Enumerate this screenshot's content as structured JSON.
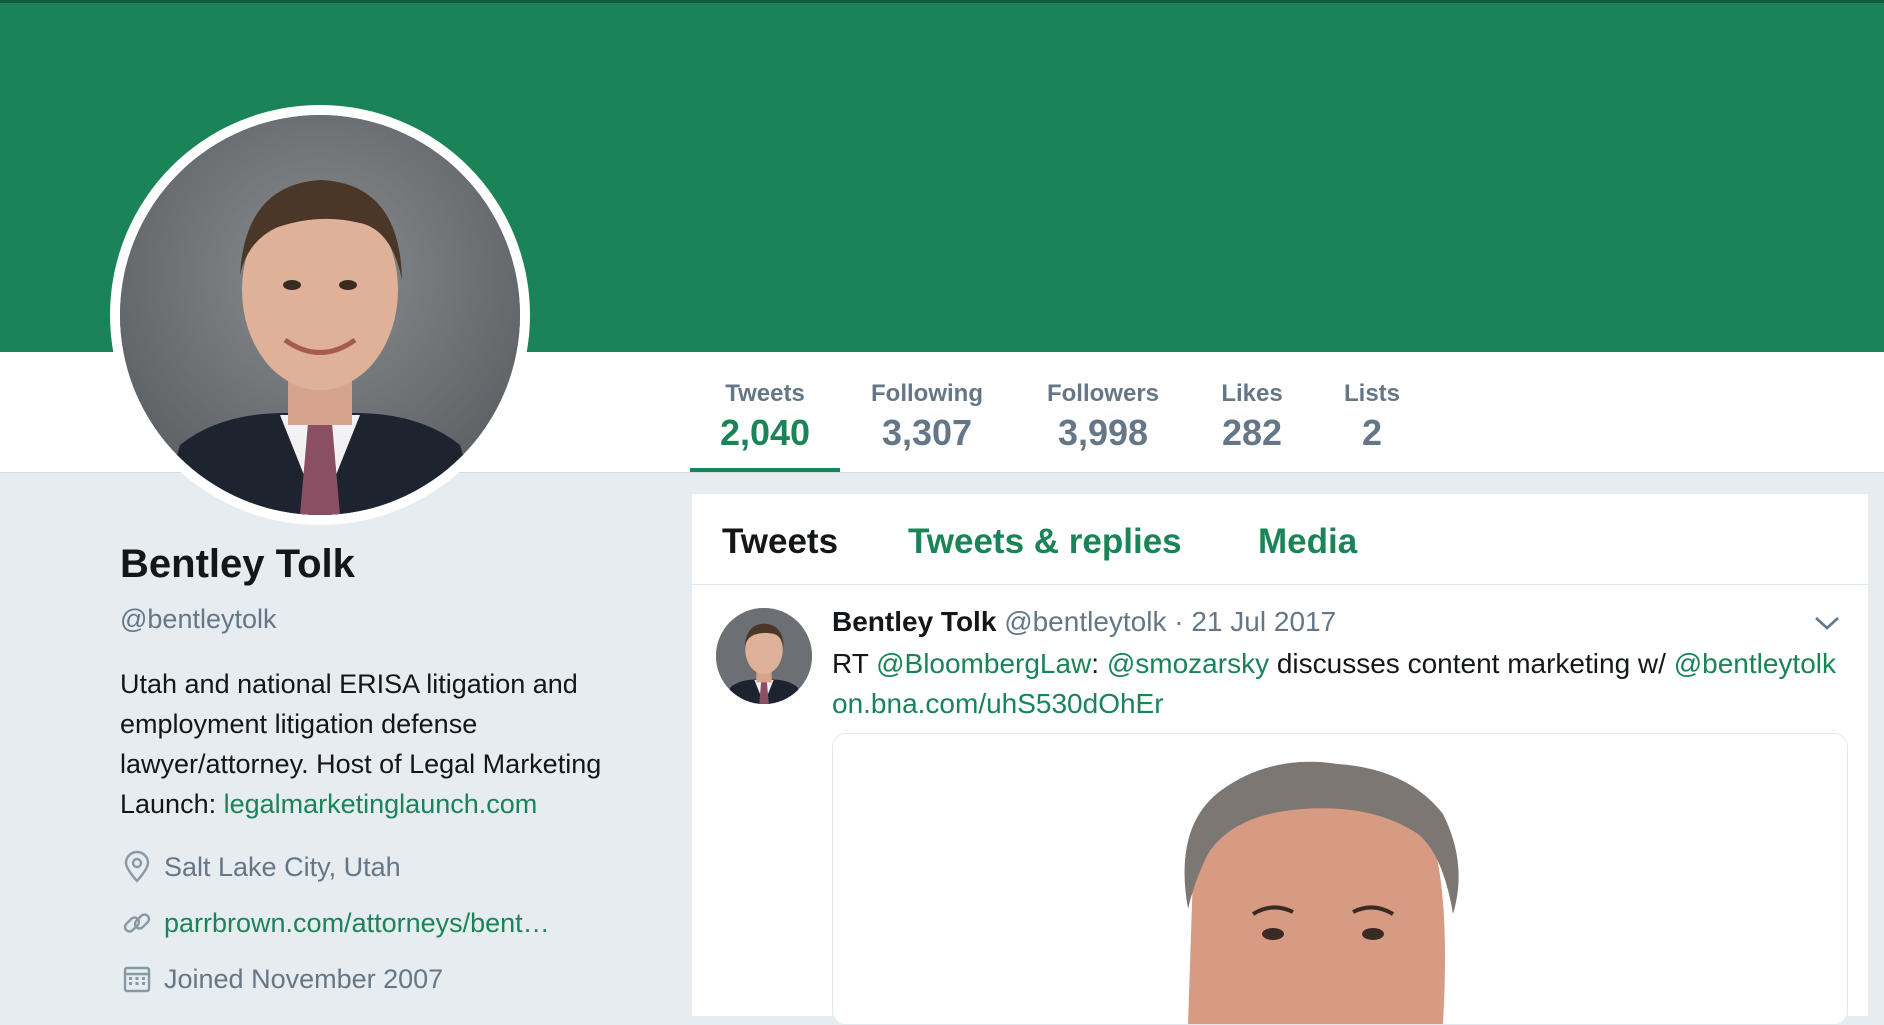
{
  "profile": {
    "name": "Bentley Tolk",
    "handle": "@bentleytolk",
    "bio_text": "Utah and national ERISA litigation and employment litigation defense lawyer/attorney. Host of Legal Marketing Launch: ",
    "bio_link": "legalmarketinglaunch.com",
    "location": "Salt Lake City, Utah",
    "website": "parrbrown.com/attorneys/bent…",
    "joined": "Joined November 2007"
  },
  "stats": [
    {
      "label": "Tweets",
      "value": "2,040"
    },
    {
      "label": "Following",
      "value": "3,307"
    },
    {
      "label": "Followers",
      "value": "3,998"
    },
    {
      "label": "Likes",
      "value": "282"
    },
    {
      "label": "Lists",
      "value": "2"
    }
  ],
  "tabs": [
    {
      "label": "Tweets"
    },
    {
      "label": "Tweets & replies"
    },
    {
      "label": "Media"
    }
  ],
  "tweet": {
    "name": "Bentley Tolk",
    "handle": "@bentleytolk",
    "sep": "·",
    "date": "21 Jul 2017",
    "rt": "RT ",
    "mention1": "@BloombergLaw",
    "colon": ": ",
    "mention2": "@smozarsky",
    "mid": " discusses content marketing w/ ",
    "mention3": "@bentleytolk",
    "link": "on.bna.com/uhS530dOhEr"
  },
  "colors": {
    "accent": "#1a8458",
    "banner": "#1a8458",
    "background": "#e6ecf0",
    "secondary_text": "#657786"
  },
  "icons": {
    "location": "map-pin-icon",
    "website": "link-icon",
    "joined": "calendar-icon",
    "caret": "chevron-down-icon"
  }
}
